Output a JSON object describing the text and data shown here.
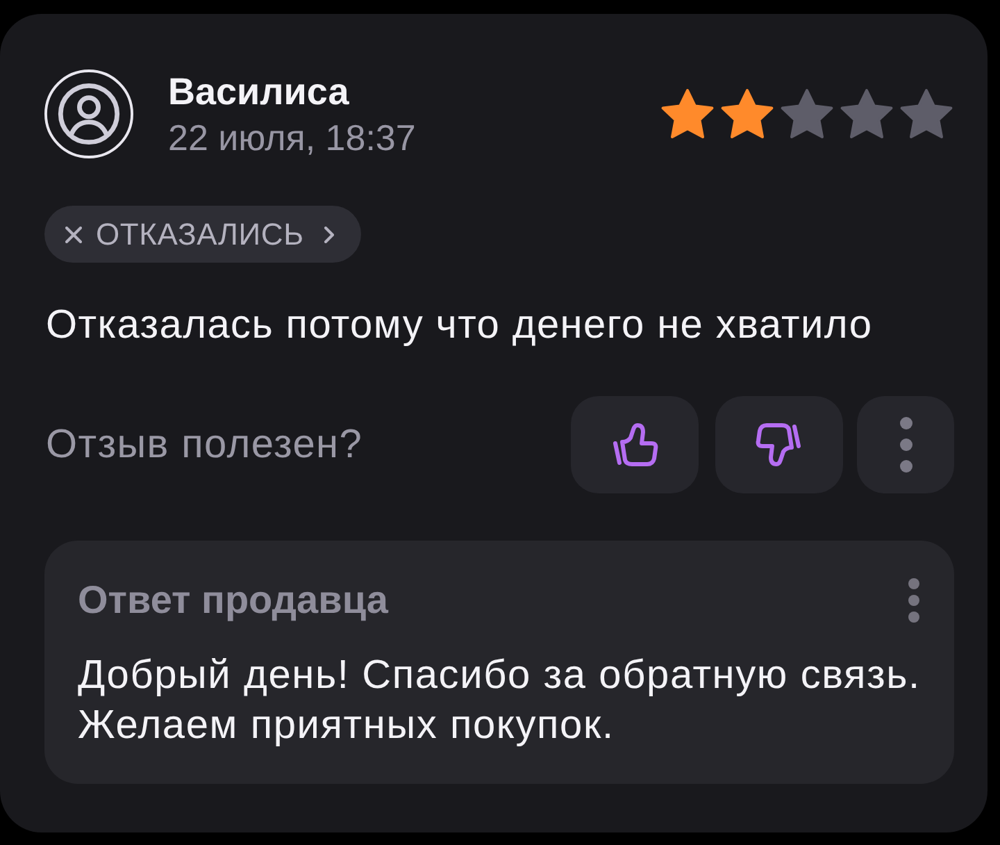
{
  "review": {
    "author": "Василиса",
    "date": "22 июля, 18:37",
    "stars": 2,
    "status_tag": {
      "label": "ОТКАЗАЛИСЬ"
    },
    "text": "Отказалась потому что денего не хватило"
  },
  "feedback": {
    "prompt": "Отзыв полезен?",
    "buttons": [
      {
        "kind": "like"
      },
      {
        "kind": "dislike"
      },
      {
        "kind": "more"
      }
    ]
  },
  "seller_reply": {
    "title": "Ответ продавца",
    "text": "Добрый день! Спасибо за обратную связь. Желаем приятных покупок."
  }
}
